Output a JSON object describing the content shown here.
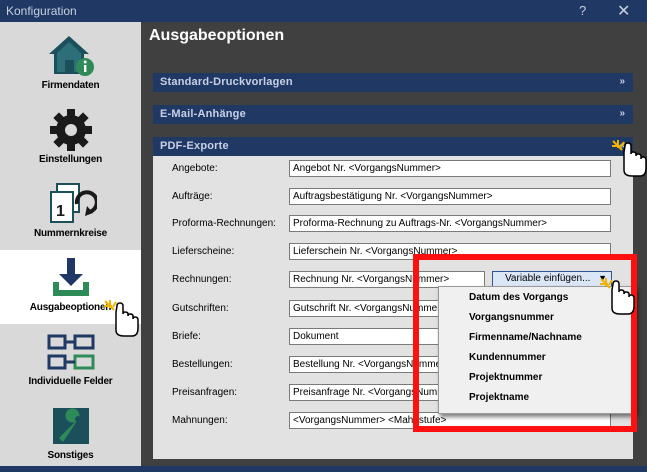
{
  "window": {
    "title": "Konfiguration",
    "help": "?",
    "close": "✕"
  },
  "sidebar": {
    "items": [
      {
        "label": "Firmendaten",
        "icon": "home-info-icon"
      },
      {
        "label": "Einstellungen",
        "icon": "gear-icon"
      },
      {
        "label": "Nummernkreise",
        "icon": "document-number-icon"
      },
      {
        "label": "Ausgabeoptionen",
        "icon": "download-icon",
        "active": true
      },
      {
        "label": "Individuelle Felder",
        "icon": "fields-icon"
      },
      {
        "label": "Sonstiges",
        "icon": "wrench-icon"
      }
    ]
  },
  "main": {
    "title": "Ausgabeoptionen",
    "sections": [
      {
        "title": "Standard-Druckvorlagen",
        "chevron": "»"
      },
      {
        "title": "E-Mail-Anhänge",
        "chevron": "»"
      },
      {
        "title": "PDF-Exporte",
        "chevron": "«"
      }
    ],
    "pdf_rows": [
      {
        "label": "Angebote:",
        "value": "Angebot Nr. <VorgangsNummer>"
      },
      {
        "label": "Aufträge:",
        "value": "Auftragsbestätigung Nr. <VorgangsNummer>"
      },
      {
        "label": "Proforma-Rechnungen:",
        "value": "Proforma-Rechnung zu Auftrags-Nr. <VorgangsNummer>"
      },
      {
        "label": "Lieferscheine:",
        "value": "Lieferschein Nr. <VorgangsNummer>"
      },
      {
        "label": "Rechnungen:",
        "value": "Rechnung Nr. <VorgangsNummer>"
      },
      {
        "label": "Gutschriften:",
        "value": "Gutschrift Nr. <VorgangsNummer>"
      },
      {
        "label": "Briefe:",
        "value": "Dokument"
      },
      {
        "label": "Bestellungen:",
        "value": "Bestellung Nr. <VorgangsNummer>"
      },
      {
        "label": "Preisanfragen:",
        "value": "Preisanfrage Nr. <VorgangsNummer>"
      },
      {
        "label": "Mahnungen:",
        "value": "<VorgangsNummer> <Mahnstufe>"
      }
    ],
    "variable_button": {
      "label": "Variable einfügen...",
      "arrow": "▼"
    },
    "variable_menu": [
      "Datum des Vorgangs",
      "Vorgangsnummer",
      "Firmenname/Nachname",
      "Kundennummer",
      "Projektnummer",
      "Projektname"
    ]
  },
  "colors": {
    "titlebar": "#1f3864",
    "section_bar": "#1f3864",
    "main_bg": "#404040",
    "panel": "#e2e2e2",
    "highlight": "#ff1010"
  }
}
